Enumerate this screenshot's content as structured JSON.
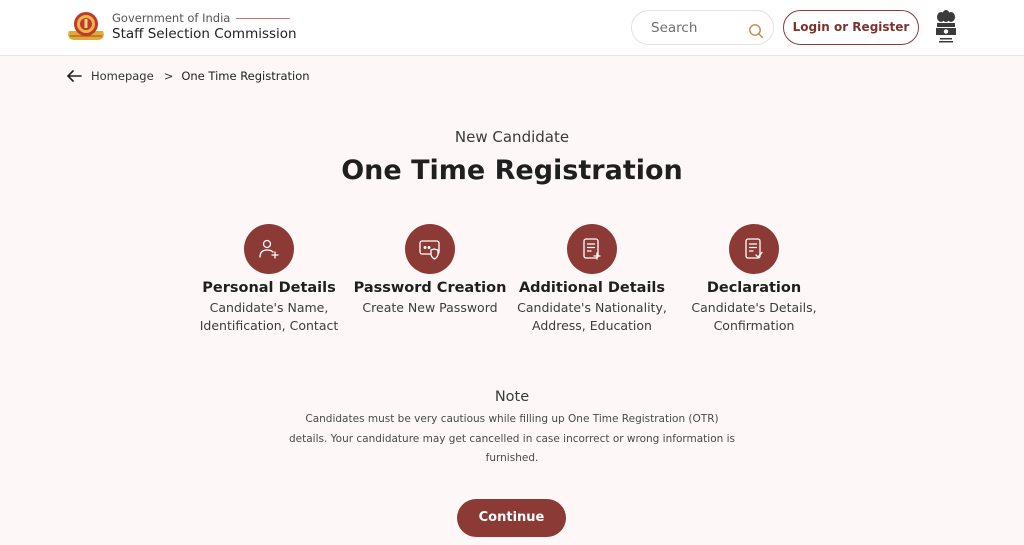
{
  "header": {
    "gov_label": "Government of India",
    "org_name": "Staff Selection Commission",
    "search_placeholder": "Search",
    "login_label": "Login or Register"
  },
  "breadcrumb": {
    "home": "Homepage",
    "separator": ">",
    "current": "One Time Registration"
  },
  "main": {
    "subtitle": "New Candidate",
    "title": "One Time Registration",
    "steps": [
      {
        "icon": "user-add-icon",
        "title": "Personal Details",
        "desc": "Candidate's Name, Identification, Contact"
      },
      {
        "icon": "password-shield-icon",
        "title": "Password Creation",
        "desc": "Create New Password"
      },
      {
        "icon": "document-add-icon",
        "title": "Additional Details",
        "desc": "Candidate's Nationality, Address, Education"
      },
      {
        "icon": "document-check-icon",
        "title": "Declaration",
        "desc": "Candidate's Details, Confirmation"
      }
    ],
    "note_title": "Note",
    "note_text": "Candidates must be very cautious while filling up One Time Registration (OTR) details. Your candidature may get cancelled in case incorrect or wrong information is furnished.",
    "continue_label": "Continue"
  },
  "colors": {
    "accent": "#8b3a36",
    "background": "#fdf8f7"
  }
}
